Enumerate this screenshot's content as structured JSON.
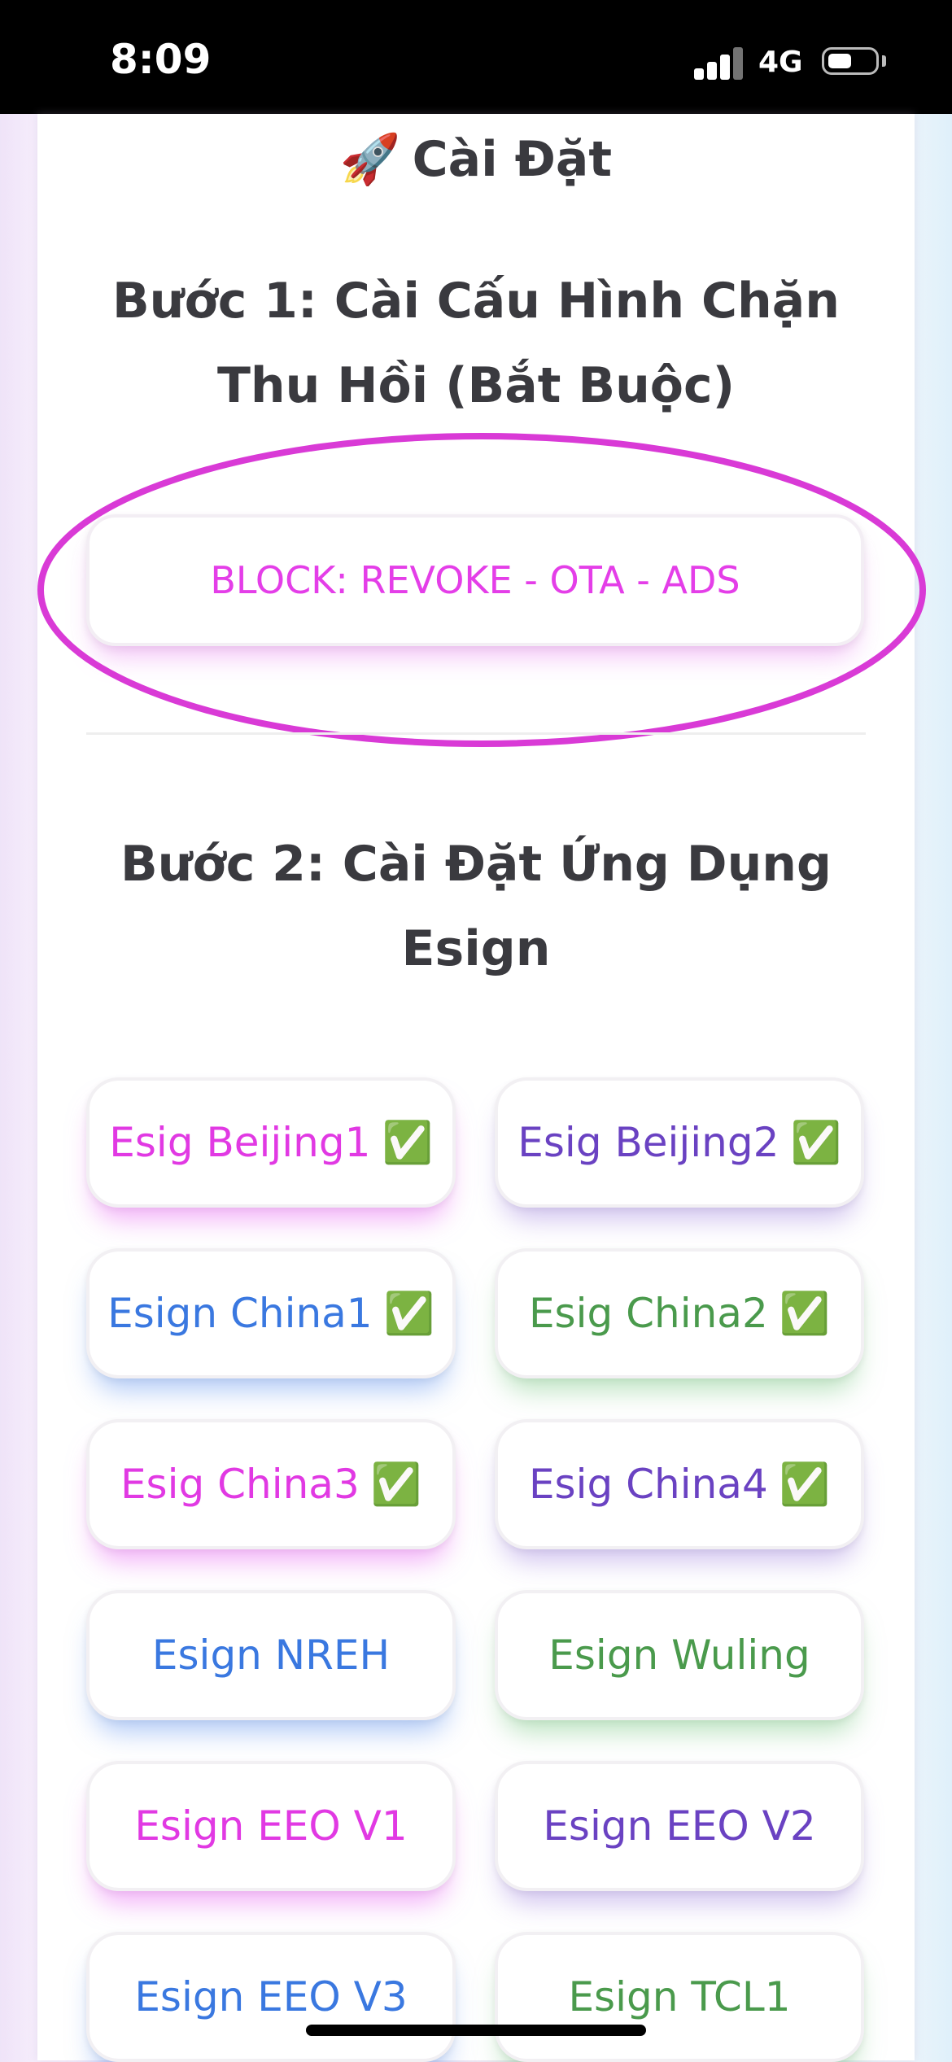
{
  "status_bar": {
    "time": "8:09",
    "network": "4G"
  },
  "install_header": {
    "icon": "🚀",
    "title": "Cài Đặt"
  },
  "step1": {
    "title": "Bước 1: Cài Cấu Hình Chặn Thu Hồi (Bắt Buộc)",
    "block_button_label": "BLOCK: REVOKE - OTA - ADS"
  },
  "step2": {
    "title": "Bước 2: Cài Đặt Ứng Dụng Esign"
  },
  "check_glyph": "✅",
  "apps": [
    {
      "label": "Esig Beijing1",
      "checked": true
    },
    {
      "label": "Esig Beijing2",
      "checked": true
    },
    {
      "label": "Esign China1",
      "checked": true
    },
    {
      "label": "Esig China2",
      "checked": true
    },
    {
      "label": "Esig China3",
      "checked": true
    },
    {
      "label": "Esig China4",
      "checked": true
    },
    {
      "label": "Esign NREH",
      "checked": false
    },
    {
      "label": "Esign Wuling",
      "checked": false
    },
    {
      "label": "Esign EEO V1",
      "checked": false
    },
    {
      "label": "Esign EEO V2",
      "checked": false
    },
    {
      "label": "Esign EEO V3",
      "checked": false
    },
    {
      "label": "Esign TCL1",
      "checked": false
    }
  ],
  "colors": {
    "pink": "#e139e3",
    "purple": "#6a42c2",
    "blue": "#3a78e0",
    "green": "#4a9a4c",
    "highlight": "#d93ad6"
  }
}
